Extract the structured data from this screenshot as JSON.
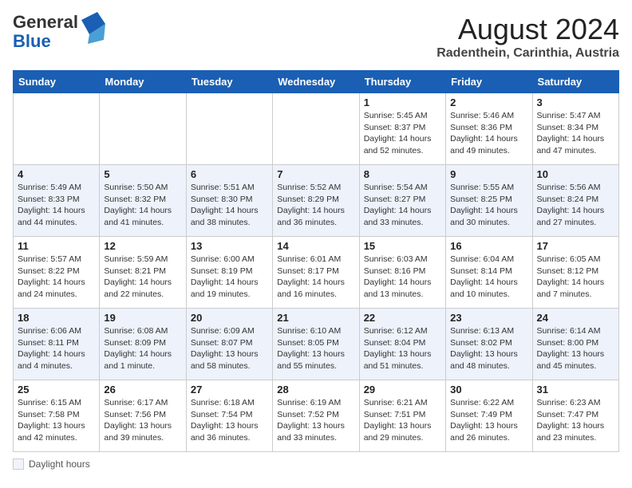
{
  "header": {
    "logo_general": "General",
    "logo_blue": "Blue",
    "main_title": "August 2024",
    "subtitle": "Radenthein, Carinthia, Austria"
  },
  "weekdays": [
    "Sunday",
    "Monday",
    "Tuesday",
    "Wednesday",
    "Thursday",
    "Friday",
    "Saturday"
  ],
  "weeks": [
    [
      {
        "day": "",
        "info": ""
      },
      {
        "day": "",
        "info": ""
      },
      {
        "day": "",
        "info": ""
      },
      {
        "day": "",
        "info": ""
      },
      {
        "day": "1",
        "info": "Sunrise: 5:45 AM\nSunset: 8:37 PM\nDaylight: 14 hours\nand 52 minutes."
      },
      {
        "day": "2",
        "info": "Sunrise: 5:46 AM\nSunset: 8:36 PM\nDaylight: 14 hours\nand 49 minutes."
      },
      {
        "day": "3",
        "info": "Sunrise: 5:47 AM\nSunset: 8:34 PM\nDaylight: 14 hours\nand 47 minutes."
      }
    ],
    [
      {
        "day": "4",
        "info": "Sunrise: 5:49 AM\nSunset: 8:33 PM\nDaylight: 14 hours\nand 44 minutes."
      },
      {
        "day": "5",
        "info": "Sunrise: 5:50 AM\nSunset: 8:32 PM\nDaylight: 14 hours\nand 41 minutes."
      },
      {
        "day": "6",
        "info": "Sunrise: 5:51 AM\nSunset: 8:30 PM\nDaylight: 14 hours\nand 38 minutes."
      },
      {
        "day": "7",
        "info": "Sunrise: 5:52 AM\nSunset: 8:29 PM\nDaylight: 14 hours\nand 36 minutes."
      },
      {
        "day": "8",
        "info": "Sunrise: 5:54 AM\nSunset: 8:27 PM\nDaylight: 14 hours\nand 33 minutes."
      },
      {
        "day": "9",
        "info": "Sunrise: 5:55 AM\nSunset: 8:25 PM\nDaylight: 14 hours\nand 30 minutes."
      },
      {
        "day": "10",
        "info": "Sunrise: 5:56 AM\nSunset: 8:24 PM\nDaylight: 14 hours\nand 27 minutes."
      }
    ],
    [
      {
        "day": "11",
        "info": "Sunrise: 5:57 AM\nSunset: 8:22 PM\nDaylight: 14 hours\nand 24 minutes."
      },
      {
        "day": "12",
        "info": "Sunrise: 5:59 AM\nSunset: 8:21 PM\nDaylight: 14 hours\nand 22 minutes."
      },
      {
        "day": "13",
        "info": "Sunrise: 6:00 AM\nSunset: 8:19 PM\nDaylight: 14 hours\nand 19 minutes."
      },
      {
        "day": "14",
        "info": "Sunrise: 6:01 AM\nSunset: 8:17 PM\nDaylight: 14 hours\nand 16 minutes."
      },
      {
        "day": "15",
        "info": "Sunrise: 6:03 AM\nSunset: 8:16 PM\nDaylight: 14 hours\nand 13 minutes."
      },
      {
        "day": "16",
        "info": "Sunrise: 6:04 AM\nSunset: 8:14 PM\nDaylight: 14 hours\nand 10 minutes."
      },
      {
        "day": "17",
        "info": "Sunrise: 6:05 AM\nSunset: 8:12 PM\nDaylight: 14 hours\nand 7 minutes."
      }
    ],
    [
      {
        "day": "18",
        "info": "Sunrise: 6:06 AM\nSunset: 8:11 PM\nDaylight: 14 hours\nand 4 minutes."
      },
      {
        "day": "19",
        "info": "Sunrise: 6:08 AM\nSunset: 8:09 PM\nDaylight: 14 hours\nand 1 minute."
      },
      {
        "day": "20",
        "info": "Sunrise: 6:09 AM\nSunset: 8:07 PM\nDaylight: 13 hours\nand 58 minutes."
      },
      {
        "day": "21",
        "info": "Sunrise: 6:10 AM\nSunset: 8:05 PM\nDaylight: 13 hours\nand 55 minutes."
      },
      {
        "day": "22",
        "info": "Sunrise: 6:12 AM\nSunset: 8:04 PM\nDaylight: 13 hours\nand 51 minutes."
      },
      {
        "day": "23",
        "info": "Sunrise: 6:13 AM\nSunset: 8:02 PM\nDaylight: 13 hours\nand 48 minutes."
      },
      {
        "day": "24",
        "info": "Sunrise: 6:14 AM\nSunset: 8:00 PM\nDaylight: 13 hours\nand 45 minutes."
      }
    ],
    [
      {
        "day": "25",
        "info": "Sunrise: 6:15 AM\nSunset: 7:58 PM\nDaylight: 13 hours\nand 42 minutes."
      },
      {
        "day": "26",
        "info": "Sunrise: 6:17 AM\nSunset: 7:56 PM\nDaylight: 13 hours\nand 39 minutes."
      },
      {
        "day": "27",
        "info": "Sunrise: 6:18 AM\nSunset: 7:54 PM\nDaylight: 13 hours\nand 36 minutes."
      },
      {
        "day": "28",
        "info": "Sunrise: 6:19 AM\nSunset: 7:52 PM\nDaylight: 13 hours\nand 33 minutes."
      },
      {
        "day": "29",
        "info": "Sunrise: 6:21 AM\nSunset: 7:51 PM\nDaylight: 13 hours\nand 29 minutes."
      },
      {
        "day": "30",
        "info": "Sunrise: 6:22 AM\nSunset: 7:49 PM\nDaylight: 13 hours\nand 26 minutes."
      },
      {
        "day": "31",
        "info": "Sunrise: 6:23 AM\nSunset: 7:47 PM\nDaylight: 13 hours\nand 23 minutes."
      }
    ]
  ],
  "footer": {
    "daylight_label": "Daylight hours"
  }
}
